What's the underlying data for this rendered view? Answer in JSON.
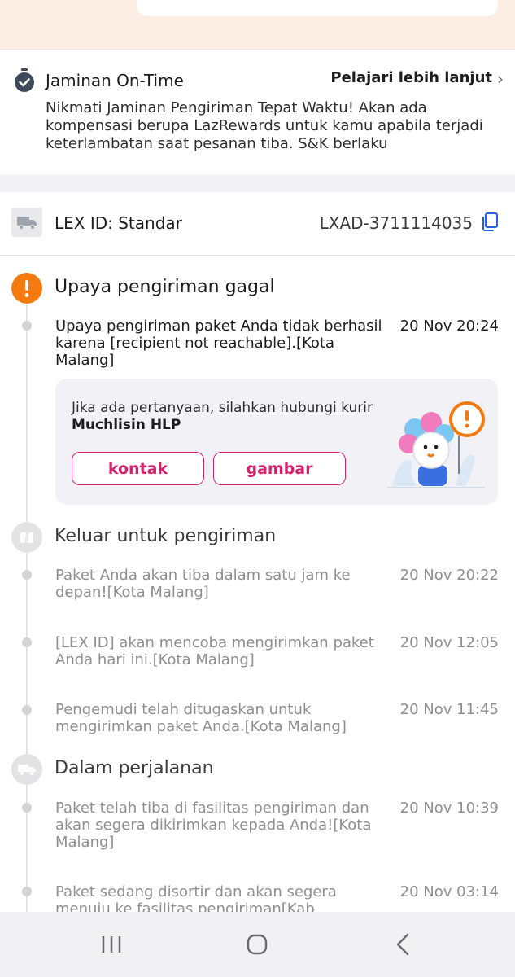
{
  "ontime": {
    "title": "Jaminan On-Time",
    "link": "Pelajari lebih lanjut",
    "description": "Nikmati Jaminan Pengiriman Tepat Waktu! Akan ada kompensasi berupa LazRewards untuk kamu apabila terjadi keterlambatan saat pesanan tiba. S&K berlaku"
  },
  "shipment": {
    "label": "LEX ID: Standar",
    "tracking_number": "LXAD-3711114035"
  },
  "statuses": [
    {
      "title": "Upaya pengiriman gagal",
      "icon": "alert-icon",
      "events": [
        {
          "text": "Upaya pengiriman paket Anda tidak berhasil karena [recipient not reachable].[Kota Malang]",
          "time": "20 Nov 20:24"
        }
      ]
    },
    {
      "title": "Keluar untuk pengiriman",
      "icon": "parcel-icon",
      "events": [
        {
          "text": "Paket Anda akan tiba dalam satu jam ke depan![Kota Malang]",
          "time": "20 Nov 20:22"
        },
        {
          "text": "[LEX ID] akan mencoba mengirimkan paket Anda hari ini.[Kota Malang]",
          "time": "20 Nov 12:05"
        },
        {
          "text": "Pengemudi telah ditugaskan untuk mengirimkan paket Anda.[Kota Malang]",
          "time": "20 Nov 11:45"
        }
      ]
    },
    {
      "title": "Dalam perjalanan",
      "icon": "truck-icon",
      "events": [
        {
          "text": "Paket telah tiba di fasilitas pengiriman dan akan segera dikirimkan kepada Anda![Kota Malang]",
          "time": "20 Nov 10:39"
        },
        {
          "text": "Paket sedang disortir dan akan segera menuju ke fasilitas pengiriman[Kab",
          "time": "20 Nov 03:14"
        }
      ]
    }
  ],
  "courier": {
    "prompt": "Jika ada pertanyaan, silahkan hubungi kurir",
    "name": "Muchlisin HLP",
    "contact_label": "kontak",
    "image_label": "gambar"
  },
  "colors": {
    "accent": "#d6226e",
    "alert": "#f47a10",
    "ontime_icon": "#3d4a5c"
  }
}
